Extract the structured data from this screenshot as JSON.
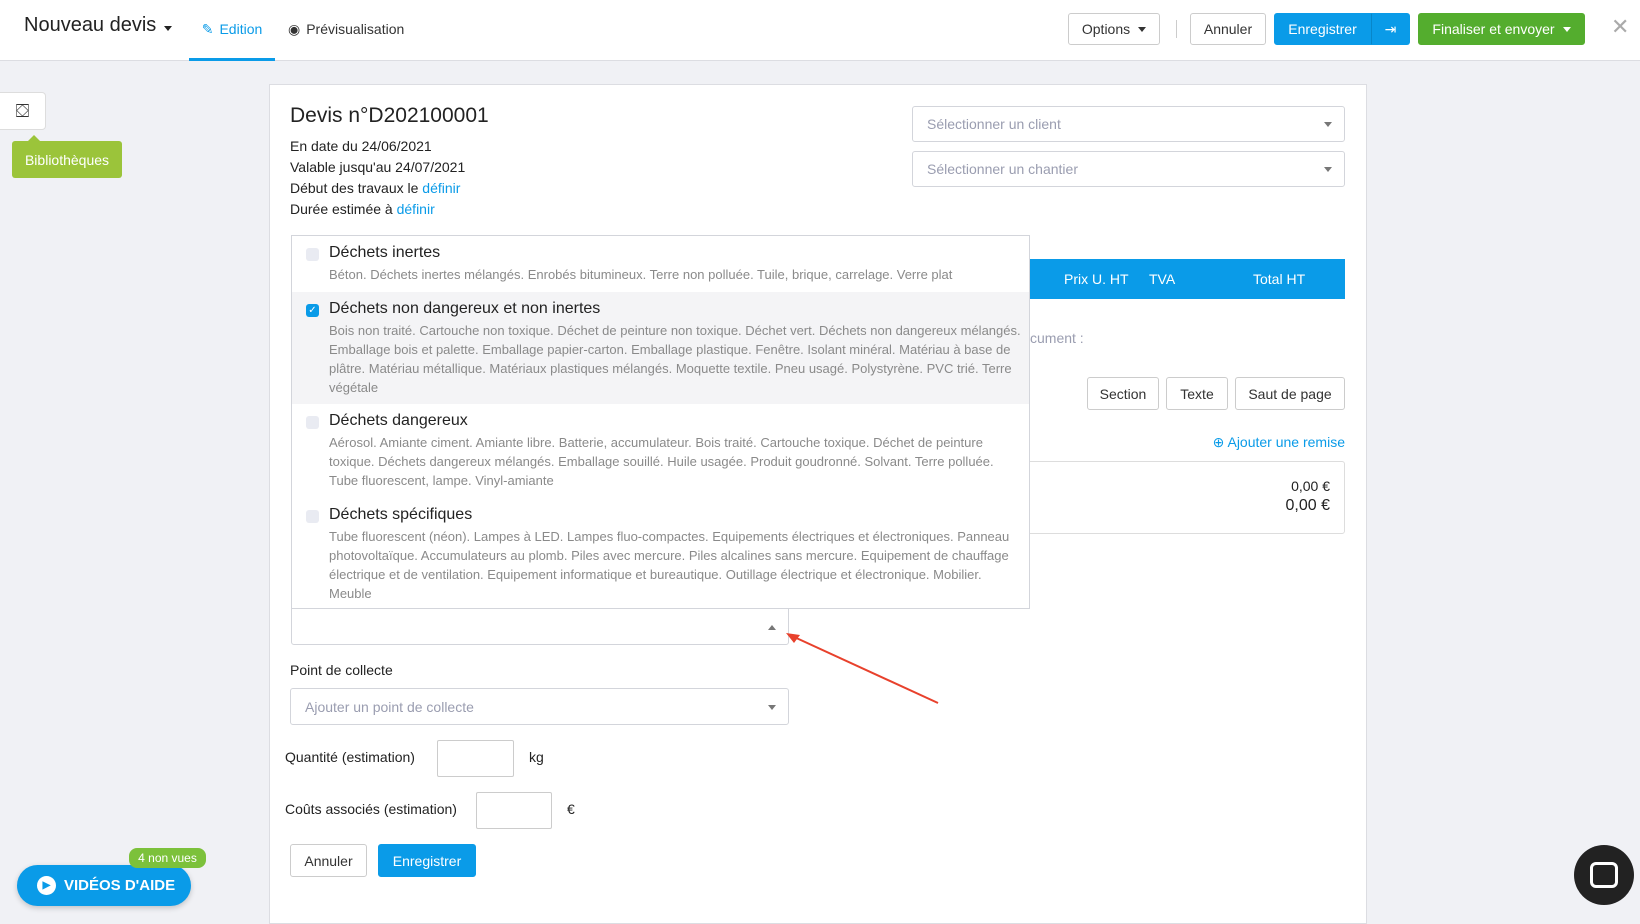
{
  "header": {
    "title": "Nouveau devis",
    "tabs": [
      {
        "label": "Edition",
        "active": true,
        "icon": "pencil-icon"
      },
      {
        "label": "Prévisualisation",
        "icon": "eye-icon"
      }
    ],
    "options": "Options",
    "cancel": "Annuler",
    "save": "Enregistrer",
    "finalize": "Finaliser et envoyer"
  },
  "sidebar": {
    "library_tooltip": "Bibliothèques",
    "library_icon": "box-open-icon"
  },
  "devis": {
    "title": "Devis n°D202100001",
    "date": "En date du 24/06/2021",
    "valid": "Valable jusqu'au 24/07/2021",
    "start_prefix": "Début des travaux le ",
    "start_link": "définir",
    "duration_prefix": "Durée estimée à ",
    "duration_link": "définir",
    "client_placeholder": "Sélectionner un client",
    "site_placeholder": "Sélectionner un chantier"
  },
  "table": {
    "headers": [
      "Prix U. HT",
      "TVA",
      "Total HT"
    ],
    "partial_text": "cument :",
    "buttons": [
      "Section",
      "Texte",
      "Saut de page"
    ],
    "add_discount": "Ajouter une remise",
    "total1": "0,00 €",
    "total2": "0,00 €"
  },
  "waste_list": [
    {
      "title": "Déchets inertes",
      "checked": false,
      "desc": "Béton. Déchets inertes mélangés. Enrobés bitumineux. Terre non polluée. Tuile, brique, carrelage. Verre plat"
    },
    {
      "title": "Déchets non dangereux et non inertes",
      "checked": true,
      "desc": "Bois non traité. Cartouche non toxique. Déchet de peinture non toxique. Déchet vert. Déchets non dangereux mélangés. Emballage bois et palette. Emballage papier-carton. Emballage plastique. Fenêtre. Isolant minéral. Matériau à base de plâtre. Matériau métallique. Matériaux plastiques mélangés. Moquette textile. Pneu usagé. Polystyrène. PVC trié. Terre végétale"
    },
    {
      "title": "Déchets dangereux",
      "checked": false,
      "desc": "Aérosol. Amiante ciment. Amiante libre. Batterie, accumulateur. Bois traité. Cartouche toxique. Déchet de peinture toxique. Déchets dangereux mélangés. Emballage souillé. Huile usagée. Produit goudronné. Solvant. Terre polluée. Tube fluorescent, lampe. Vinyl-amiante"
    },
    {
      "title": "Déchets spécifiques",
      "checked": false,
      "desc": "Tube fluorescent (néon). Lampes à LED. Lampes fluo-compactes. Equipements électriques et électroniques. Panneau photovoltaïque. Accumulateurs au plomb. Piles avec mercure. Piles alcalines sans mercure. Equipement de chauffage électrique et de ventilation. Equipement informatique et bureautique. Outillage électrique et électronique. Mobilier. Meuble"
    }
  ],
  "form": {
    "collect_label": "Point de collecte",
    "collect_placeholder": "Ajouter un point de collecte",
    "qty_label": "Quantité (estimation)",
    "qty_unit": "kg",
    "cost_label": "Coûts associés (estimation)",
    "cost_unit": "€",
    "cancel": "Annuler",
    "save": "Enregistrer"
  },
  "help": {
    "label": "VIDÉOS D'AIDE",
    "badge": "4 non vues"
  },
  "colors": {
    "primary": "#0a9be8",
    "success": "#54ad2e",
    "library": "#9bc43a",
    "annotation_arrow": "#e8412c"
  }
}
